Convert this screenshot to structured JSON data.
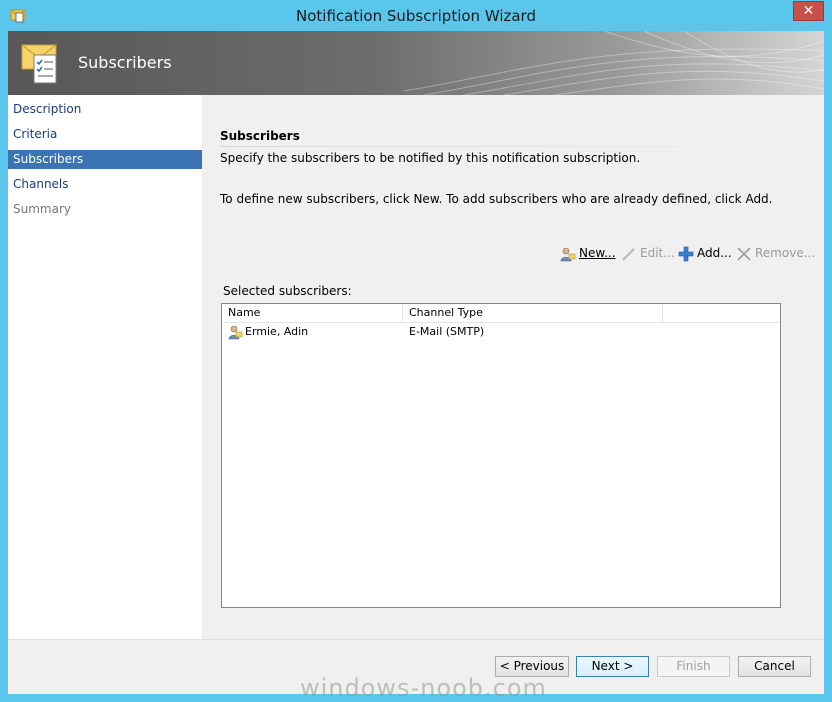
{
  "window": {
    "title": "Notification Subscription Wizard",
    "close_label": "✕"
  },
  "header": {
    "title": "Subscribers",
    "icon": "envelope-checklist-icon"
  },
  "nav": {
    "items": [
      {
        "label": "Description",
        "state": "normal"
      },
      {
        "label": "Criteria",
        "state": "normal"
      },
      {
        "label": "Subscribers",
        "state": "selected"
      },
      {
        "label": "Channels",
        "state": "normal"
      },
      {
        "label": "Summary",
        "state": "disabled"
      }
    ]
  },
  "main": {
    "section_title": "Subscribers",
    "description": "Specify the subscribers to be notified by this notification subscription.",
    "instructions": "To define new subscribers, click New.  To add subscribers who are already defined, click Add.",
    "toolbar": {
      "new_label": "New...",
      "edit_label": "Edit...",
      "add_label": "Add...",
      "remove_label": "Remove..."
    },
    "selected_label": "Selected subscribers:",
    "grid": {
      "columns": [
        "Name",
        "Channel Type"
      ],
      "rows": [
        {
          "name": "Ermie, Adin",
          "channel": "E-Mail (SMTP)"
        }
      ]
    }
  },
  "footer": {
    "previous_label": "< Previous",
    "next_label": "Next >",
    "finish_label": "Finish",
    "cancel_label": "Cancel"
  },
  "watermark": "windows-noob.com",
  "colors": {
    "titlebar": "#5bc6ec",
    "nav_selected": "#3c73b3",
    "nav_link": "#1c3d7a",
    "close_button": "#c7504b"
  }
}
